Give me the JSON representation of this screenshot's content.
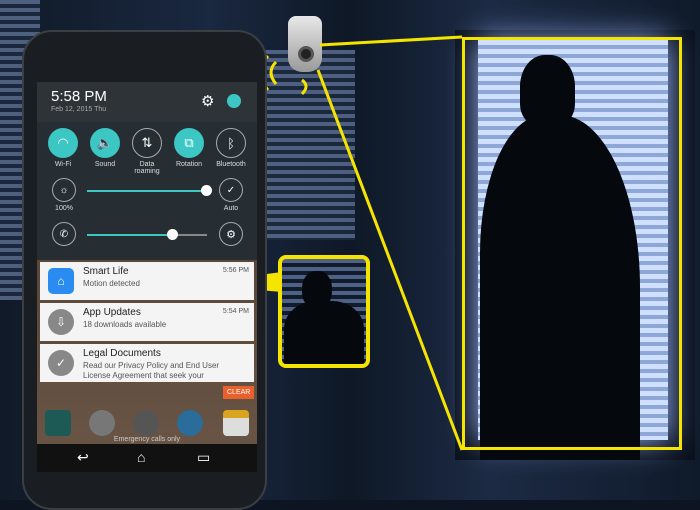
{
  "status": {
    "time": "5:58 PM",
    "date": "Feb 12, 2015 Thu"
  },
  "quick_settings": [
    {
      "label": "Wi-Fi",
      "icon": "wifi-icon",
      "on": true
    },
    {
      "label": "Sound",
      "icon": "sound-icon",
      "on": true
    },
    {
      "label": "Data roaming",
      "icon": "data-roaming-icon",
      "on": false
    },
    {
      "label": "Rotation",
      "icon": "rotation-icon",
      "on": true
    },
    {
      "label": "Bluetooth",
      "icon": "bluetooth-icon",
      "on": false
    }
  ],
  "brightness": {
    "label": "100%",
    "level": 1.0,
    "auto_label": "Auto"
  },
  "volume": {
    "level": 0.7
  },
  "notifications": [
    {
      "app": "Smart Life",
      "text": "Motion detected",
      "time": "5:56 PM"
    },
    {
      "app": "App Updates",
      "text": "18 downloads available",
      "time": "5:54 PM"
    },
    {
      "app": "Legal Documents",
      "text": "Read our Privacy Policy and End User License Agreement that seek your",
      "time": ""
    }
  ],
  "clear_label": "CLEAR",
  "emergency": "Emergency calls only",
  "colors": {
    "accent": "#3cc7c4",
    "highlight": "#f5e400",
    "clear": "#e8602c"
  }
}
